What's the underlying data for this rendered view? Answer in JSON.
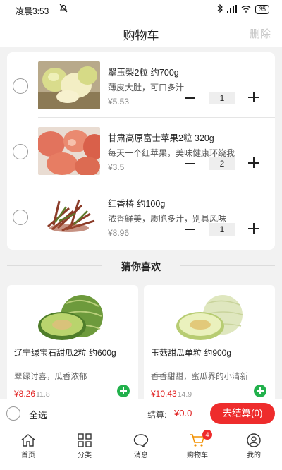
{
  "status_bar": {
    "time": "凌晨3:53",
    "battery": "35"
  },
  "header": {
    "title": "购物车",
    "delete_label": "删除"
  },
  "cart": {
    "items": [
      {
        "name": "翠玉梨2粒 约700g",
        "desc": "薄皮大肚，可口多汁",
        "price": "¥5.53",
        "qty": "1"
      },
      {
        "name": "甘肃高原富士苹果2粒 320g",
        "desc": "每天一个红苹果，美味健康环绕我",
        "price": "¥3.5",
        "qty": "2"
      },
      {
        "name": "红香椿 约100g",
        "desc": "浓香鲜美，质脆多汁，别具风味",
        "price": "¥8.96",
        "qty": "1"
      }
    ]
  },
  "recommend": {
    "title": "猜你喜欢",
    "products": [
      {
        "name": "辽宁绿宝石甜瓜2粒 约600g",
        "desc": "翠绿讨喜，瓜香浓郁",
        "price": "¥8.26",
        "old_price": "11.8"
      },
      {
        "name": "玉菇甜瓜单粒 约900g",
        "desc": "香香甜甜，蜜瓜界的小清新",
        "price": "¥10.43",
        "old_price": "14.9"
      }
    ]
  },
  "checkout": {
    "select_all": "全选",
    "total_label": "结算:",
    "total": "¥0.0",
    "button": "去结算(0)"
  },
  "tabbar": {
    "tabs": [
      {
        "label": "首页",
        "icon": "home-icon"
      },
      {
        "label": "分类",
        "icon": "category-grid-icon"
      },
      {
        "label": "消息",
        "icon": "message-bubble-icon"
      },
      {
        "label": "购物车",
        "icon": "cart-icon",
        "badge": "4"
      },
      {
        "label": "我的",
        "icon": "user-icon"
      }
    ]
  },
  "colors": {
    "accent_red": "#ee2c2c",
    "price_red": "#e02020",
    "add_green": "#22b14c",
    "cart_active": "#f29100"
  }
}
